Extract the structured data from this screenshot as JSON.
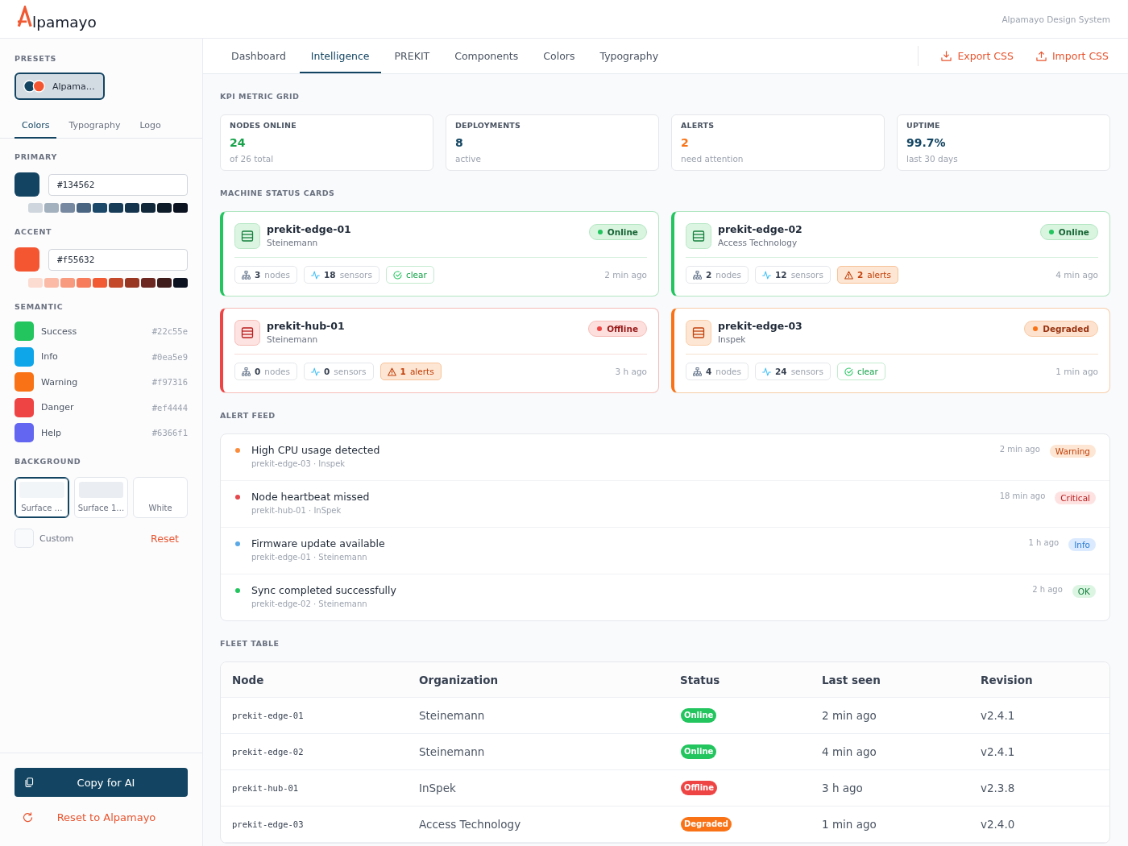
{
  "header": {
    "logo_text": "lpamayo",
    "subtitle": "Alpamayo Design System"
  },
  "sidebar": {
    "presets": {
      "label": "PRESETS",
      "items": [
        {
          "label": "Alpama…",
          "selected": true
        }
      ]
    },
    "tabs": [
      {
        "label": "Colors",
        "selected": true
      },
      {
        "label": "Typography",
        "selected": false
      },
      {
        "label": "Logo",
        "selected": false
      }
    ],
    "primary": {
      "label": "PRIMARY",
      "color": "#134562",
      "value": "#134562",
      "shades": [
        {
          "color": "#cfd6dd"
        },
        {
          "color": "#a3b0bd"
        },
        {
          "color": "#7789a0"
        },
        {
          "color": "#4a6582"
        },
        {
          "color": "#1b4768"
        },
        {
          "color": "#163c58"
        },
        {
          "color": "#13344c"
        },
        {
          "color": "#10283a"
        },
        {
          "color": "#0e1c29"
        },
        {
          "color": "#0b1220"
        }
      ]
    },
    "accent": {
      "label": "ACCENT",
      "color": "#f55632",
      "value": "#f55632",
      "shades": [
        {
          "color": "#fcdcd1"
        },
        {
          "color": "#fbbaa5"
        },
        {
          "color": "#f89a7e"
        },
        {
          "color": "#f77c5c"
        },
        {
          "color": "#f15a33"
        },
        {
          "color": "#c4482a"
        },
        {
          "color": "#983622"
        },
        {
          "color": "#6c2820"
        },
        {
          "color": "#3f1c1c"
        },
        {
          "color": "#0c1220"
        }
      ]
    },
    "semantic": {
      "label": "SEMANTIC",
      "items": [
        {
          "name": "Success",
          "value": "#22c55e",
          "color": "#22c55e"
        },
        {
          "name": "Info",
          "value": "#0ea5e9",
          "color": "#0ea5e9"
        },
        {
          "name": "Warning",
          "value": "#f97316",
          "color": "#f97316"
        },
        {
          "name": "Danger",
          "value": "#ef4444",
          "color": "#ef4444"
        },
        {
          "name": "Help",
          "value": "#6366f1",
          "color": "#6366f1"
        }
      ]
    },
    "background": {
      "label": "BACKGROUND",
      "options": [
        {
          "label": "Surface …",
          "selected": true,
          "color": "#f2f5f8"
        },
        {
          "label": "Surface 1…",
          "selected": false,
          "color": "#eaeef3"
        },
        {
          "label": "White",
          "selected": false
        }
      ],
      "custom_label": "Custom",
      "reset": "Reset"
    },
    "copy_button": "Copy for AI",
    "reset_button": "Reset to Alpamayo"
  },
  "nav": {
    "tabs": [
      {
        "label": "Dashboard",
        "selected": false
      },
      {
        "label": "Intelligence",
        "selected": true
      },
      {
        "label": "PREKIT",
        "selected": false
      },
      {
        "label": "Components",
        "selected": false
      },
      {
        "label": "Colors",
        "selected": false
      },
      {
        "label": "Typography",
        "selected": false
      }
    ],
    "actions": [
      {
        "kind": "export",
        "label": "Export CSS"
      },
      {
        "kind": "import",
        "label": "Import CSS"
      }
    ]
  },
  "kpi": {
    "title": "KPI METRIC GRID",
    "cards": [
      {
        "label": "NODES ONLINE",
        "value": "24",
        "sub": "of 26 total",
        "color": "#16a34a"
      },
      {
        "label": "DEPLOYMENTS",
        "value": "8",
        "sub": "active",
        "color": "#134562"
      },
      {
        "label": "ALERTS",
        "value": "2",
        "sub": "need attention",
        "color": "#f97316"
      },
      {
        "label": "UPTIME",
        "value": "99.7%",
        "sub": "last 30 days",
        "color": "#134562"
      }
    ]
  },
  "machines": {
    "title": "MACHINE STATUS CARDS",
    "cards": [
      {
        "kind": "online",
        "name": "prekit-edge-01",
        "org": "Steinemann",
        "status": "Online",
        "chips": [
          {
            "kind": "nodes",
            "count": "3",
            "label": "nodes"
          },
          {
            "kind": "sensors",
            "count": "18",
            "label": "sensors"
          },
          {
            "kind": "clear",
            "label": "clear"
          }
        ],
        "time": "2 min ago"
      },
      {
        "kind": "online",
        "name": "prekit-edge-02",
        "org": "Access Technology",
        "status": "Online",
        "chips": [
          {
            "kind": "nodes",
            "count": "2",
            "label": "nodes"
          },
          {
            "kind": "sensors",
            "count": "12",
            "label": "sensors"
          },
          {
            "kind": "alerts",
            "count": "2",
            "label": "alerts"
          }
        ],
        "time": "4 min ago"
      },
      {
        "kind": "offline",
        "name": "prekit-hub-01",
        "org": "Steinemann",
        "status": "Offline",
        "chips": [
          {
            "kind": "nodes",
            "count": "0",
            "label": "nodes"
          },
          {
            "kind": "sensors",
            "count": "0",
            "label": "sensors"
          },
          {
            "kind": "alerts",
            "count": "1",
            "label": "alerts"
          }
        ],
        "time": "3 h ago"
      },
      {
        "kind": "degraded",
        "name": "prekit-edge-03",
        "org": "Inspek",
        "status": "Degraded",
        "chips": [
          {
            "kind": "nodes",
            "count": "4",
            "label": "nodes"
          },
          {
            "kind": "sensors",
            "count": "24",
            "label": "sensors"
          },
          {
            "kind": "clear",
            "label": "clear"
          }
        ],
        "time": "1 min ago"
      }
    ]
  },
  "alert_feed": {
    "title": "ALERT FEED",
    "items": [
      {
        "kind": "warning",
        "title": "High CPU usage detected",
        "source": "prekit-edge-03 · Inspek",
        "time": "2 min ago",
        "severity": "Warning"
      },
      {
        "kind": "critical",
        "title": "Node heartbeat missed",
        "source": "prekit-hub-01 · InSpek",
        "time": "18 min ago",
        "severity": "Critical"
      },
      {
        "kind": "info",
        "title": "Firmware update available",
        "source": "prekit-edge-01 · Steinemann",
        "time": "1 h ago",
        "severity": "Info"
      },
      {
        "kind": "ok",
        "title": "Sync completed successfully",
        "source": "prekit-edge-02 · Steinemann",
        "time": "2 h ago",
        "severity": "OK"
      }
    ]
  },
  "fleet_table": {
    "title": "FLEET TABLE",
    "columns": [
      "Node",
      "Organization",
      "Status",
      "Last seen",
      "Revision"
    ],
    "rows": [
      {
        "kind": "online",
        "node": "prekit-edge-01",
        "organization": "Steinemann",
        "status": "Online",
        "last_seen": "2 min ago",
        "revision": "v2.4.1"
      },
      {
        "kind": "online",
        "node": "prekit-edge-02",
        "organization": "Steinemann",
        "status": "Online",
        "last_seen": "4 min ago",
        "revision": "v2.4.1"
      },
      {
        "kind": "offline",
        "node": "prekit-hub-01",
        "organization": "InSpek",
        "status": "Offline",
        "last_seen": "3 h ago",
        "revision": "v2.3.8"
      },
      {
        "kind": "degraded",
        "node": "prekit-edge-03",
        "organization": "Access Technology",
        "status": "Degraded",
        "last_seen": "1 min ago",
        "revision": "v2.4.0"
      }
    ]
  }
}
